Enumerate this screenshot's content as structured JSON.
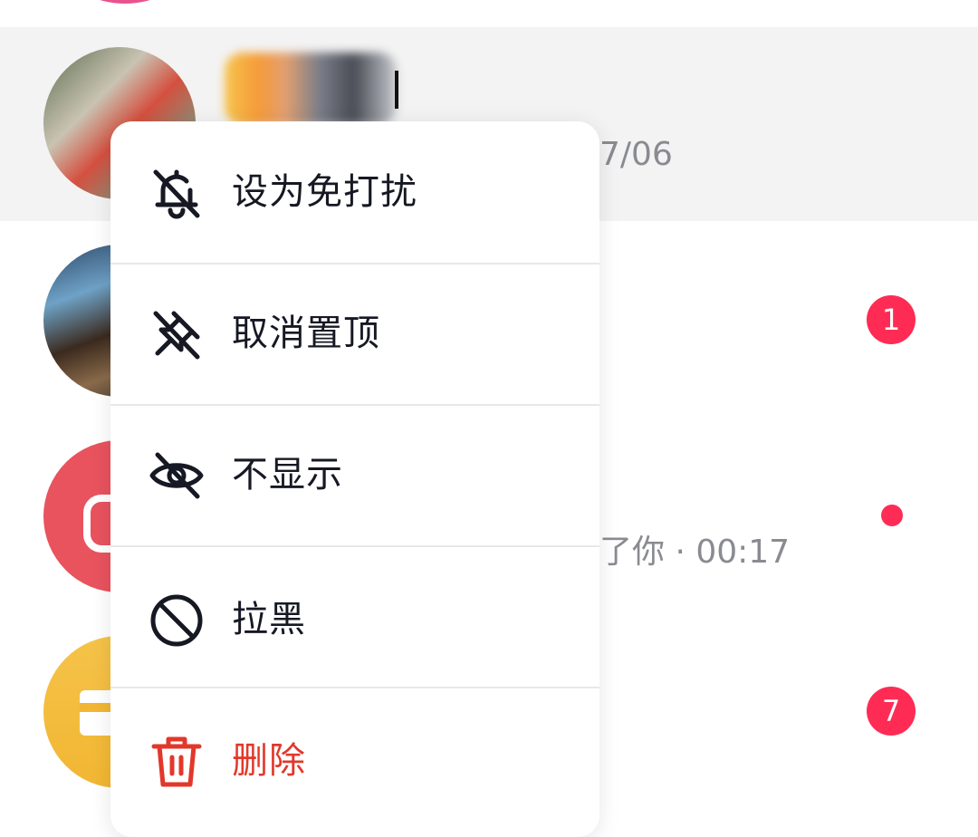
{
  "chat_list": {
    "rows": [
      {
        "meta": "7/06"
      },
      {
        "badge": "1"
      },
      {
        "meta": "了你 · 00:17",
        "unread_dot": true
      },
      {
        "badge": "7"
      }
    ]
  },
  "context_menu": {
    "items": [
      {
        "label": "设为免打扰",
        "icon": "bell-off-icon"
      },
      {
        "label": "取消置顶",
        "icon": "unpin-icon"
      },
      {
        "label": "不显示",
        "icon": "eye-off-icon"
      },
      {
        "label": "拉黑",
        "icon": "block-icon"
      },
      {
        "label": "删除",
        "icon": "trash-icon",
        "color": "#e2382b"
      }
    ]
  },
  "colors": {
    "badge": "#fe2c55",
    "danger": "#e2382b",
    "highlight_row": "#f3f3f3"
  }
}
